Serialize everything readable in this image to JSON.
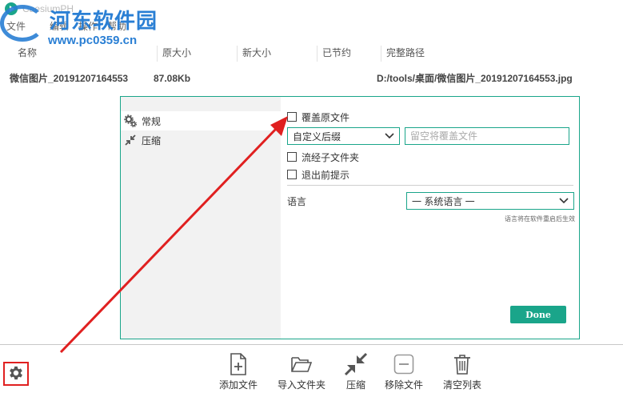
{
  "window": {
    "title": "CaesiumPH"
  },
  "watermark": {
    "title": "河东软件园",
    "url": "www.pc0359.cn"
  },
  "menu": [
    "文件",
    "编辑",
    "操作",
    "帮助"
  ],
  "columns": [
    "名称",
    "原大小",
    "新大小",
    "已节约",
    "完整路径"
  ],
  "file": {
    "name": "微信图片_20191207164553",
    "original_size": "87.08Kb",
    "path": "D:/tools/桌面/微信图片_20191207164553.jpg"
  },
  "settings": {
    "sidebar": [
      {
        "label": "常规",
        "icon": "gears-icon"
      },
      {
        "label": "压缩",
        "icon": "compress-icon"
      }
    ],
    "overwrite_label": "覆盖原文件",
    "suffix_select": "自定义后缀",
    "suffix_placeholder": "留空将覆盖文件",
    "subfolders_label": "流经子文件夹",
    "exit_prompt_label": "退出前提示",
    "language_label": "语言",
    "language_select": "一 系统语言 一",
    "language_hint": "语言将在软件重启后生效",
    "done_label": "Done"
  },
  "toolbar": [
    {
      "label": "添加文件",
      "icon": "add-file-icon"
    },
    {
      "label": "导入文件夹",
      "icon": "folder-open-icon"
    },
    {
      "label": "压缩",
      "icon": "compress-icon"
    },
    {
      "label": "移除文件",
      "icon": "remove-icon"
    },
    {
      "label": "清空列表",
      "icon": "trash-icon"
    }
  ],
  "colors": {
    "accent": "#1aa58a",
    "annotation": "#e02020",
    "watermark": "#2a7fd4"
  }
}
